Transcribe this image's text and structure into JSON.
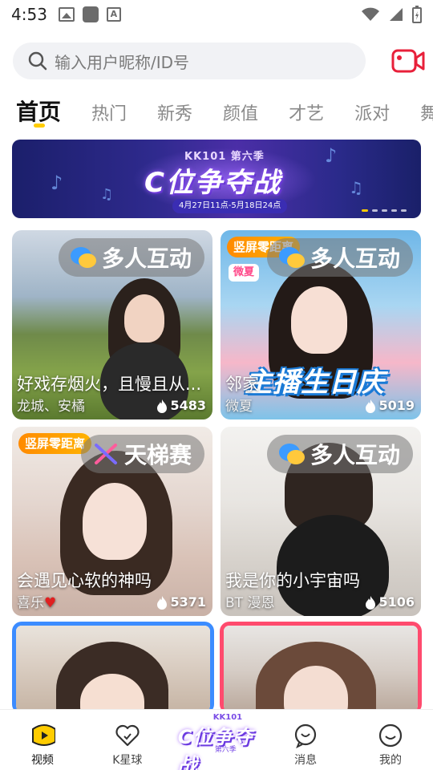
{
  "status_bar": {
    "time": "4:53"
  },
  "search": {
    "placeholder": "输入用户昵称/ID号"
  },
  "tabs": [
    {
      "label": "首页"
    },
    {
      "label": "热门"
    },
    {
      "label": "新秀"
    },
    {
      "label": "颜值"
    },
    {
      "label": "才艺"
    },
    {
      "label": "派对"
    },
    {
      "label": "舞"
    }
  ],
  "banner": {
    "top": "KK101 第六季",
    "title": "C位争夺战",
    "subtitle": "4月27日11点-5月18日24点",
    "slide_count": 5,
    "active_slide": 1
  },
  "cards": [
    {
      "category": "多人互动",
      "title": "好戏存烟火，且慢且从...",
      "name": "龙城、安橘",
      "count": "5483",
      "tag": ""
    },
    {
      "category": "多人互动",
      "title": "邻家",
      "name": "微夏",
      "count": "5019",
      "tag": "竖屏零距离",
      "badge": "微夏",
      "overlay": "主播生日庆"
    },
    {
      "category": "天梯赛",
      "title": "会遇见心软的神吗",
      "name": "喜乐",
      "count": "5371",
      "tag": "竖屏零距离"
    },
    {
      "category": "多人互动",
      "title": "我是你的小宇宙吗",
      "name": "BT 漫恩",
      "count": "5106",
      "tag": ""
    }
  ],
  "bottom_nav": {
    "items": [
      {
        "label": "视频"
      },
      {
        "label": "K星球"
      },
      {
        "label": "消息"
      },
      {
        "label": "我的"
      }
    ],
    "center": {
      "top": "KK101",
      "title": "C位争夺战",
      "sub": "第六季"
    }
  },
  "colors": {
    "accent": "#ffcc00",
    "tag": "#ff8a00",
    "frame_blue": "#3c8cff",
    "frame_red": "#ff4b6e"
  }
}
